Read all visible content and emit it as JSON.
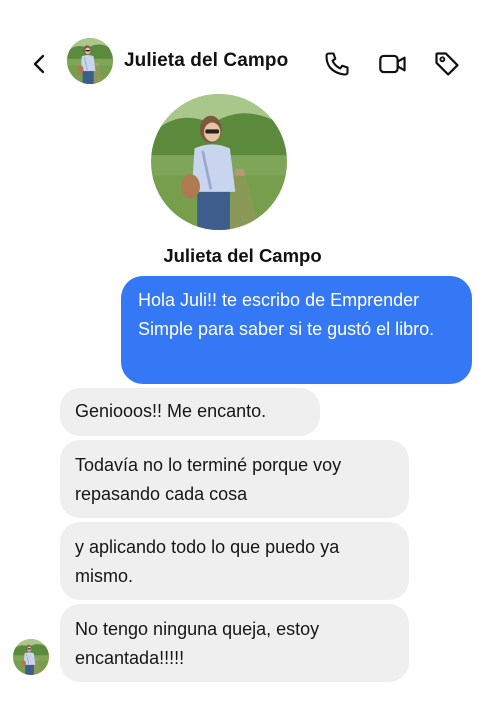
{
  "header": {
    "contact_name": "Julieta del Campo",
    "icons": [
      "back-icon",
      "phone-icon",
      "video-camera-icon",
      "tag-icon"
    ]
  },
  "profile": {
    "name": "Julieta del Campo"
  },
  "messages": [
    {
      "direction": "sent",
      "text": "Hola Juli!! te escribo de Emprender Simple para saber si te gustó el libro."
    },
    {
      "direction": "received",
      "text": "Geniooos!! Me encanto."
    },
    {
      "direction": "received",
      "text": "Todavía no lo terminé porque voy repasando cada cosa"
    },
    {
      "direction": "received",
      "text": "y aplicando todo lo que puedo ya mismo."
    },
    {
      "direction": "received",
      "text": "No tengo ninguna queja, estoy encantada!!!!!"
    }
  ],
  "colors": {
    "sent_bubble": "#3478f6",
    "received_bubble": "#efefef",
    "background": "#ffffff"
  }
}
